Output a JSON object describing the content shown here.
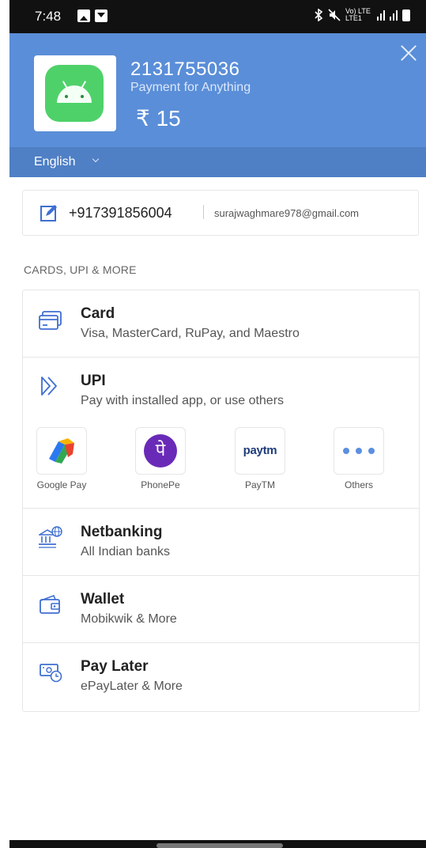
{
  "status_bar": {
    "time": "7:48",
    "network_label": "Vo) LTE LTE1"
  },
  "header": {
    "merchant_id": "2131755036",
    "description": "Payment for Anything",
    "amount": "₹ 15",
    "background_color": "#5a8ed8",
    "language": "English"
  },
  "contact": {
    "phone": "+917391856004",
    "email": "surajwaghmare978@gmail.com"
  },
  "section_title": "CARDS, UPI & MORE",
  "methods": {
    "card": {
      "title": "Card",
      "subtitle": "Visa, MasterCard, RuPay, and Maestro",
      "icon": "card-icon"
    },
    "upi": {
      "title": "UPI",
      "subtitle": "Pay with installed app, or use others",
      "icon": "upi-icon",
      "apps": [
        {
          "label": "Google Pay",
          "icon": "google-pay-icon"
        },
        {
          "label": "PhonePe",
          "icon": "phonepe-icon",
          "glyph": "पे"
        },
        {
          "label": "PayTM",
          "icon": "paytm-icon",
          "wordmark": "paytm"
        },
        {
          "label": "Others",
          "icon": "more-dots-icon"
        }
      ]
    },
    "netbanking": {
      "title": "Netbanking",
      "subtitle": "All Indian banks",
      "icon": "bank-icon"
    },
    "wallet": {
      "title": "Wallet",
      "subtitle": "Mobikwik & More",
      "icon": "wallet-icon"
    },
    "pay_later": {
      "title": "Pay Later",
      "subtitle": "ePayLater & More",
      "icon": "pay-later-icon"
    }
  },
  "colors": {
    "accent": "#5a8ed8",
    "icon_blue": "#3f6fd1"
  }
}
